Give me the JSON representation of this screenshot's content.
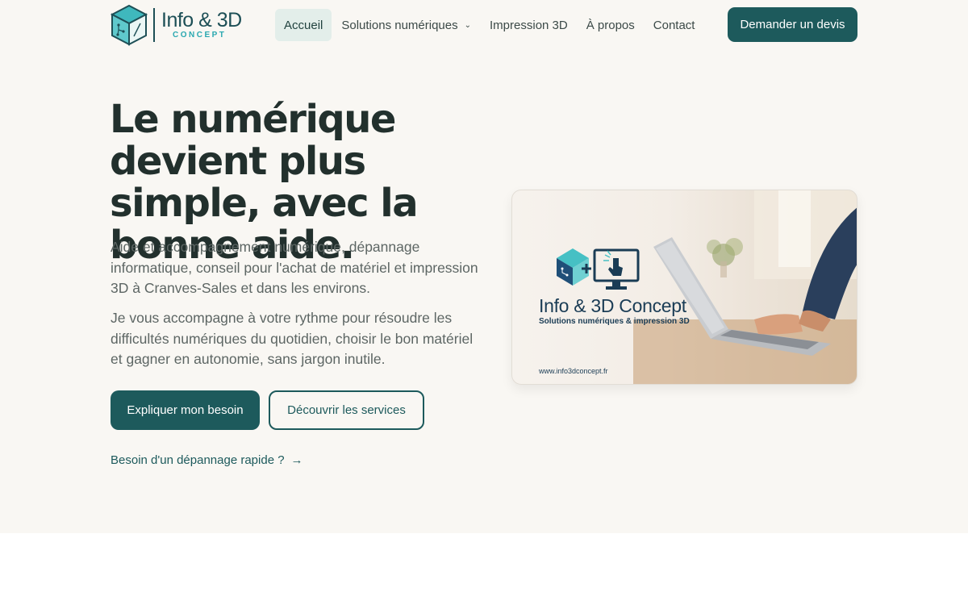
{
  "brand": {
    "logo_main": "Info & 3D",
    "logo_sub": "CONCEPT"
  },
  "nav": {
    "items": [
      {
        "label": "Accueil",
        "active": true
      },
      {
        "label": "Solutions numériques",
        "has_dropdown": true
      },
      {
        "label": "Impression 3D"
      },
      {
        "label": "À propos"
      },
      {
        "label": "Contact"
      }
    ],
    "cta_label": "Demander un devis"
  },
  "hero": {
    "headline": "Le numérique devient plus simple, avec la bonne aide.",
    "paragraph_1": "Aide et accompagnement numérique, dépannage informatique, conseil pour l'achat de matériel et impression 3D à Cranves-Sales et dans les environs.",
    "paragraph_2": "Je vous accompagne à votre rythme pour résoudre les difficultés numériques du quotidien, choisir le bon matériel et gagner en autonomie, sans jargon inutile.",
    "primary_button": "Expliquer mon besoin",
    "secondary_button": "Découvrir les services",
    "quick_link": "Besoin d'un dépannage rapide ?",
    "quick_link_arrow": "→"
  },
  "hero_image": {
    "brand_name": "Info & 3D Concept",
    "tagline": "Solutions numériques & impression 3D",
    "url": "www.info3dconcept.fr"
  },
  "colors": {
    "primary": "#1d5a5c",
    "hero_background": "#f9f7f3",
    "active_nav_background": "#e3eeea",
    "heading": "#22302d",
    "body_text": "#5d6664",
    "logo_teal": "#2aa8b0"
  }
}
